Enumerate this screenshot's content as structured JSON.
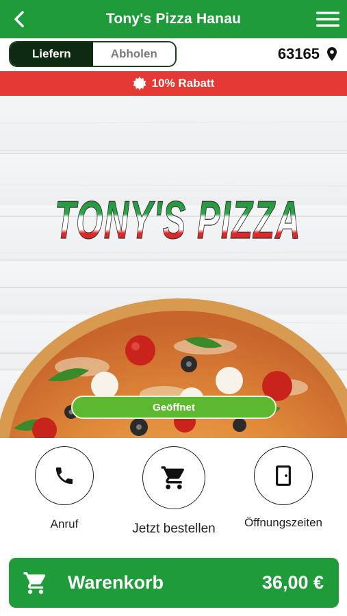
{
  "header": {
    "title": "Tony's Pizza Hanau"
  },
  "mode": {
    "deliver_label": "Liefern",
    "pickup_label": "Abholen",
    "selected": "Liefern"
  },
  "location": {
    "postal_code": "63165"
  },
  "promo": {
    "text": "10% Rabatt"
  },
  "hero": {
    "logo_text": "TONY'S PIZZA",
    "status_label": "Geöffnet"
  },
  "actions": [
    {
      "label": "Anruf",
      "icon": "phone-icon"
    },
    {
      "label": "Jetzt bestellen",
      "icon": "cart-icon"
    },
    {
      "label": "Öffnungszeiten",
      "icon": "door-icon"
    }
  ],
  "cart": {
    "label": "Warenkorb",
    "total": "36,00 €"
  },
  "colors": {
    "primary": "#1f9b3a",
    "promo": "#e53935",
    "open": "#5cb82f",
    "toggle_active": "#0e2a13"
  }
}
